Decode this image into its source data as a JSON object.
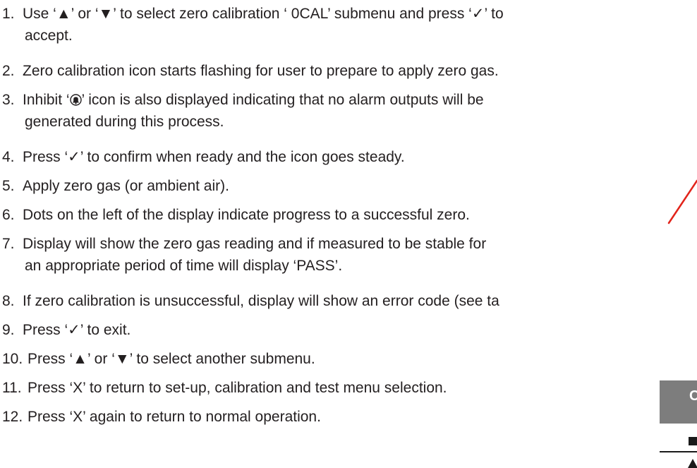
{
  "steps": [
    {
      "num": "1.",
      "text": "Use ‘▲’ or ‘▼’ to select zero calibration ‘ 0CAL’ submenu and press ‘✓’ to",
      "cont": "accept."
    },
    {
      "num": "2.",
      "text": "Zero calibration icon starts flashing for user to prepare to apply zero gas."
    },
    {
      "num": "3.",
      "text_before": "Inhibit ‘",
      "text_after": "’ icon is also displayed indicating that no alarm outputs will be",
      "cont": "generated during this process."
    },
    {
      "num": "4.",
      "text": "Press ‘✓’ to confirm when ready and the icon goes steady."
    },
    {
      "num": "5.",
      "text": "Apply zero gas (or ambient air)."
    },
    {
      "num": "6.",
      "text": "Dots on the left of the display indicate progress to a successful zero."
    },
    {
      "num": "7.",
      "text": "Display will show the zero gas reading and if measured to be stable for",
      "cont": "an appropriate period of time will display ‘PASS’."
    },
    {
      "num": "8.",
      "text": "If zero calibration is unsuccessful, display will show an error code (see ta"
    },
    {
      "num": "9.",
      "text": "Press ‘✓’ to exit."
    },
    {
      "num": "10.",
      "text": "Press ‘▲’ or ‘▼’ to select another submenu."
    },
    {
      "num": "11.",
      "text": "Press ‘X’ to return to set-up, calibration and test menu selection."
    },
    {
      "num": "12.",
      "text": "Press ‘X’ again to return to normal operation."
    }
  ],
  "side_panel": {
    "label": "C"
  },
  "colors": {
    "pointer_line": "#e2231a",
    "panel_gray": "#7d7d7d",
    "text": "#231f20"
  },
  "icons": {
    "inhibit": "inhibit-bell-icon"
  }
}
